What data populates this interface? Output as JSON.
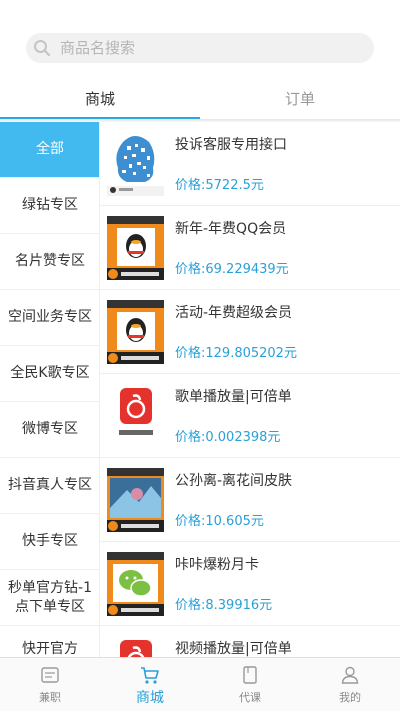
{
  "search": {
    "placeholder": "商品名搜索"
  },
  "tabs": [
    {
      "label": "商城"
    },
    {
      "label": "订单"
    }
  ],
  "sidebar": {
    "items": [
      {
        "label": "全部",
        "active": true
      },
      {
        "label": "绿钻专区"
      },
      {
        "label": "名片赞专区"
      },
      {
        "label": "空间业务专区"
      },
      {
        "label": "全民K歌专区"
      },
      {
        "label": "微博专区"
      },
      {
        "label": "抖音真人专区"
      },
      {
        "label": "快手专区"
      },
      {
        "label": "秒单官方钻-1点下单专区"
      },
      {
        "label": "快开官方"
      }
    ]
  },
  "products": [
    {
      "title": "投诉客服专用接口",
      "price": "价格:5722.5元",
      "thumb": "qr-code"
    },
    {
      "title": "新年-年费QQ会员",
      "price": "价格:69.229439元",
      "thumb": "qq-penguin"
    },
    {
      "title": "活动-年费超级会员",
      "price": "价格:129.805202元",
      "thumb": "qq-penguin"
    },
    {
      "title": "歌单播放量|可倍单",
      "price": "价格:0.002398元",
      "thumb": "netease-music"
    },
    {
      "title": "公孙离-离花间皮肤",
      "price": "价格:10.605元",
      "thumb": "game-skin"
    },
    {
      "title": "咔咔爆粉月卡",
      "price": "价格:8.39916元",
      "thumb": "wechat"
    },
    {
      "title": "视频播放量|可倍单",
      "price": "",
      "thumb": "netease-music"
    }
  ],
  "bottom_nav": [
    {
      "label": "兼职",
      "icon": "document-icon"
    },
    {
      "label": "商城",
      "icon": "cart-icon",
      "active": true
    },
    {
      "label": "代课",
      "icon": "book-icon"
    },
    {
      "label": "我的",
      "icon": "person-icon"
    }
  ],
  "colors": {
    "accent": "#2aa0d8",
    "sidebar_active": "#42b9ef",
    "tab_underline": "#2aa9e0"
  }
}
